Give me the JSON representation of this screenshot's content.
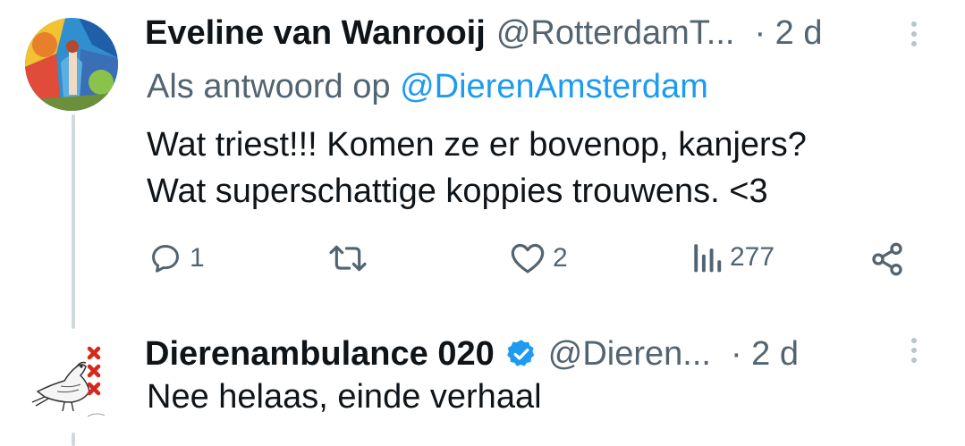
{
  "tweets": [
    {
      "author_name": "Eveline van Wanrooij",
      "handle": "@RotterdamT...",
      "time": "· 2 d",
      "reply_to_prefix": "Als antwoord op",
      "reply_to_handle": "@DierenAmsterdam",
      "text_lines": [
        "Wat triest!!! Komen ze er bovenop, kanjers?",
        "Wat superschattige koppies trouwens. <3"
      ],
      "actions": {
        "reply_count": "1",
        "retweet_count": "",
        "like_count": "2",
        "view_count": "277"
      },
      "avatar_icon": "colorful-mural-avatar"
    },
    {
      "author_name": "Dierenambulance 020",
      "verified": true,
      "handle": "@Dieren...",
      "time": "· 2 d",
      "text_lines": [
        "Nee helaas, einde verhaal"
      ],
      "avatar_icon": "pigeon-xxx-logo"
    }
  ],
  "colors": {
    "accent": "#1d9bf0",
    "secondary_text": "#536471",
    "thread_line": "#cfd9de",
    "amsterdam_red": "#d9261c"
  }
}
